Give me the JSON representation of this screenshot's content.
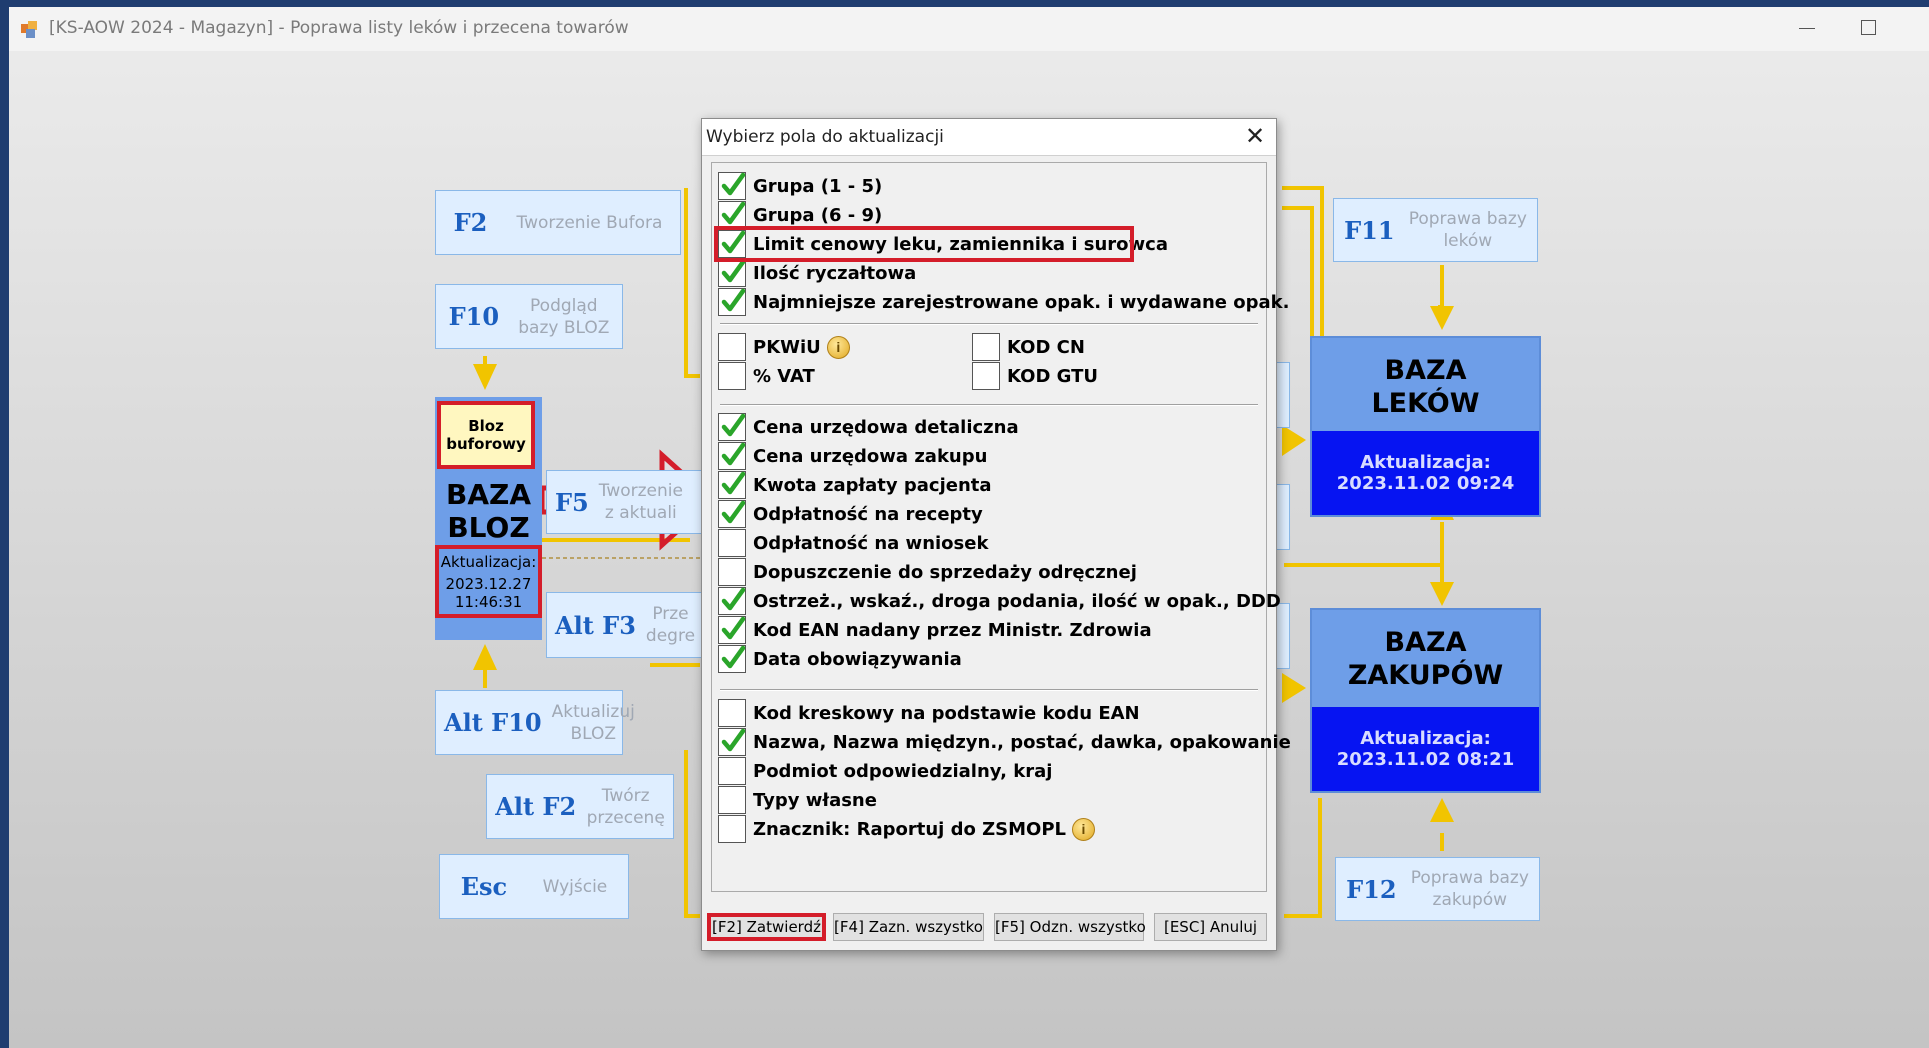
{
  "window": {
    "title": "[KS-AOW 2024 - Magazyn] - Poprawa listy leków i przecena towarów"
  },
  "colors": {
    "accent_blue": "#1b5fbf",
    "connector_yellow": "#f1c400",
    "highlight_red": "#d41d2a",
    "db_fill": "#6e9ee8",
    "db_update": "#0614f2"
  },
  "actions": {
    "f2": {
      "key": "F2",
      "desc1": "Tworzenie Bufora"
    },
    "f10": {
      "key": "F10",
      "desc1": "Podgląd",
      "desc2": "bazy BLOZ"
    },
    "f5": {
      "key": "F5",
      "desc1": "Tworzenie",
      "desc2": "z aktuali"
    },
    "altf3": {
      "key": "Alt F3",
      "desc1": "Prze",
      "desc2": "degre"
    },
    "altf10": {
      "key": "Alt F10",
      "desc1": "Aktualizuj",
      "desc2": "BLOZ"
    },
    "altf2": {
      "key": "Alt F2",
      "desc1": "Twórz",
      "desc2": "przecenę"
    },
    "esc": {
      "key": "Esc",
      "desc1": "Wyjście"
    },
    "f11": {
      "key": "F11",
      "desc1": "Poprawa bazy",
      "desc2": "leków"
    },
    "f12": {
      "key": "F12",
      "desc1": "Poprawa bazy",
      "desc2": "zakupów"
    }
  },
  "bloz": {
    "buffer_line1": "Bloz",
    "buffer_line2": "buforowy",
    "name_line1": "BAZA",
    "name_line2": "BLOZ",
    "update_label": "Aktualizacja:",
    "update_date": "2023.12.27",
    "update_time": "11:46:31"
  },
  "baza_lekow": {
    "name_line1": "BAZA",
    "name_line2": "LEKÓW",
    "update_label": "Aktualizacja:",
    "update_value": "2023.11.02 09:24"
  },
  "baza_zakupow": {
    "name_line1": "BAZA",
    "name_line2": "ZAKUPÓW",
    "update_label": "Aktualizacja:",
    "update_value": "2023.11.02 08:21"
  },
  "dialog": {
    "title": "Wybierz pola do aktualizacji",
    "group1": [
      {
        "label": "Grupa (1 - 5)",
        "checked": true
      },
      {
        "label": "Grupa (6 - 9)",
        "checked": true
      },
      {
        "label": "Limit cenowy leku, zamiennika i surowca",
        "checked": true
      },
      {
        "label": "Ilość ryczałtowa",
        "checked": true
      },
      {
        "label": "Najmniejsze zarejestrowane opak. i wydawane opak.",
        "checked": true
      }
    ],
    "group2": [
      {
        "label": "PKWiU",
        "checked": false
      },
      {
        "label": "% VAT",
        "checked": false
      },
      {
        "label": "KOD CN",
        "checked": false
      },
      {
        "label": "KOD GTU",
        "checked": false
      }
    ],
    "group3": [
      {
        "label": "Cena urzędowa detaliczna",
        "checked": true
      },
      {
        "label": "Cena urzędowa zakupu",
        "checked": true
      },
      {
        "label": "Kwota zapłaty pacjenta",
        "checked": true
      },
      {
        "label": "Odpłatność na recepty",
        "checked": true
      },
      {
        "label": "Odpłatność na wniosek",
        "checked": false
      },
      {
        "label": "Dopuszczenie do sprzedaży odręcznej",
        "checked": false
      },
      {
        "label": "Ostrzeż., wskaź., droga podania, ilość w opak., DDD",
        "checked": true
      },
      {
        "label": "Kod EAN nadany przez Ministr. Zdrowia",
        "checked": true
      },
      {
        "label": "Data obowiązywania",
        "checked": true
      }
    ],
    "group4": [
      {
        "label": "Kod kreskowy na podstawie kodu EAN",
        "checked": false
      },
      {
        "label": "Nazwa, Nazwa międzyn., postać, dawka, opakowanie",
        "checked": true
      },
      {
        "label": "Podmiot odpowiedzialny, kraj",
        "checked": false
      },
      {
        "label": "Typy własne",
        "checked": false
      },
      {
        "label": "Znacznik: Raportuj do ZSMOPL",
        "checked": false
      }
    ],
    "buttons": {
      "confirm": "[F2] Zatwierdź",
      "select_all": "[F4] Zazn. wszystko",
      "deselect_all": "[F5] Odzn. wszystko",
      "cancel": "[ESC] Anuluj"
    }
  }
}
